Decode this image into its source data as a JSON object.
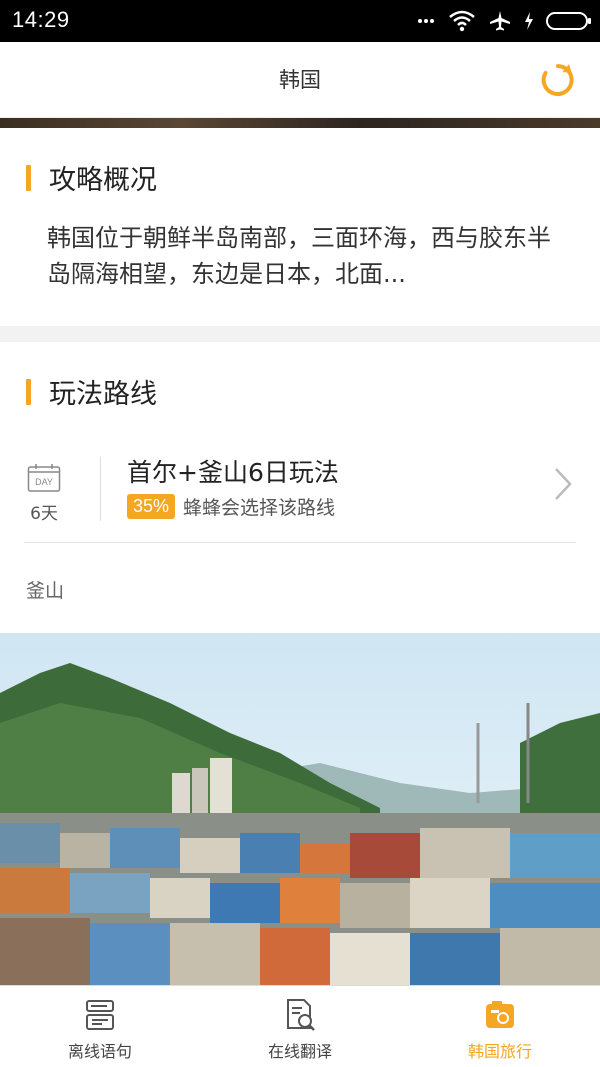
{
  "status_bar": {
    "time": "14:29"
  },
  "header": {
    "title": "韩国"
  },
  "overview": {
    "title": "攻略概况",
    "text": "韩国位于朝鲜半岛南部，三面环海，西与胶东半岛隔海相望，东边是日本，北面..."
  },
  "routes": {
    "title": "玩法路线",
    "items": [
      {
        "day_icon_text": "DAY",
        "days": "6天",
        "name": "首尔+釜山6日玩法",
        "percent": "35%",
        "meta": "蜂蜂会选择该路线"
      }
    ],
    "city": "釜山"
  },
  "tabs": [
    {
      "label": "离线语句",
      "icon": "phrasebook-icon"
    },
    {
      "label": "在线翻译",
      "icon": "translate-doc-icon"
    },
    {
      "label": "韩国旅行",
      "icon": "travel-camera-icon",
      "active": true
    }
  ],
  "colors": {
    "accent": "#f5a623",
    "status_bar": "#000000"
  }
}
